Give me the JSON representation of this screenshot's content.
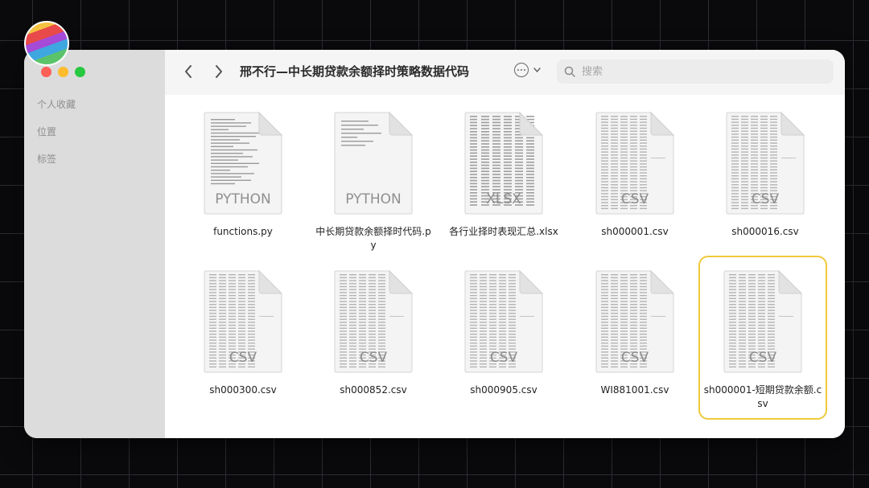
{
  "window": {
    "title": "邢不行—中长期贷款余额择时策略数据代码"
  },
  "sidebar": {
    "items": [
      {
        "label": "个人收藏"
      },
      {
        "label": "位置"
      },
      {
        "label": "标签"
      }
    ]
  },
  "search": {
    "placeholder": "搜索"
  },
  "files": [
    {
      "name": "functions.py",
      "type": "PYTHON",
      "style": "py-dense"
    },
    {
      "name": "中长期贷款余额择时代码.py",
      "type": "PYTHON",
      "style": "py-sparse"
    },
    {
      "name": "各行业择时表现汇总.xlsx",
      "type": "XLSX",
      "style": "table"
    },
    {
      "name": "sh000001.csv",
      "type": "CSV",
      "style": "csv"
    },
    {
      "name": "sh000016.csv",
      "type": "CSV",
      "style": "csv"
    },
    {
      "name": "sh000300.csv",
      "type": "CSV",
      "style": "csv"
    },
    {
      "name": "sh000852.csv",
      "type": "CSV",
      "style": "csv"
    },
    {
      "name": "sh000905.csv",
      "type": "CSV",
      "style": "csv"
    },
    {
      "name": "WI881001.csv",
      "type": "CSV",
      "style": "csv"
    },
    {
      "name": "sh000001-短期贷款余额.csv",
      "type": "CSV",
      "style": "csv",
      "selected": true
    }
  ],
  "colors": {
    "selection": "#f0c93b",
    "accent": "#28c840"
  }
}
